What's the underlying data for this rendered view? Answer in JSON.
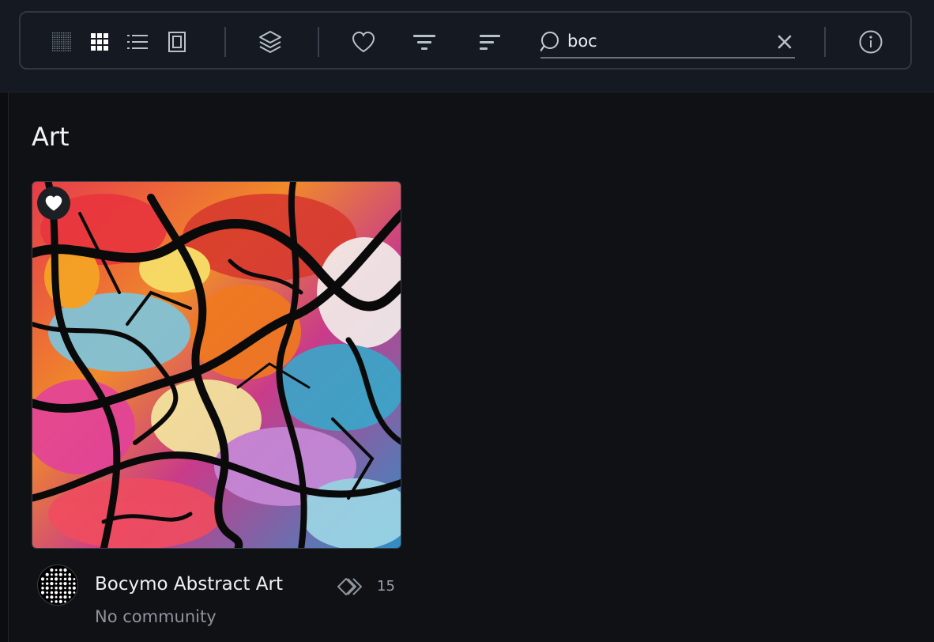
{
  "toolbar": {
    "view_modes": [
      {
        "name": "dense-grid-view",
        "icon": "dense-grid-icon"
      },
      {
        "name": "grid-view",
        "icon": "grid-icon",
        "active": true
      },
      {
        "name": "list-view",
        "icon": "list-icon"
      },
      {
        "name": "single-view",
        "icon": "single-card-icon"
      }
    ],
    "icons": [
      "layers-icon",
      "heart-icon",
      "filter-icon",
      "sort-icon",
      "search-icon",
      "close-icon",
      "info-icon"
    ]
  },
  "search": {
    "value": "boc",
    "placeholder": ""
  },
  "section": {
    "title": "Art"
  },
  "item": {
    "title": "Bocymo Abstract Art",
    "subtitle": "No community",
    "count": "15",
    "favorited": true
  },
  "colors": {
    "background": "#0f1115",
    "topbar": "#151a22",
    "toolbar_border": "#2f3742",
    "icon": "#b9c0c9",
    "active_icon": "#ffffff",
    "muted_text": "#8d949d"
  }
}
